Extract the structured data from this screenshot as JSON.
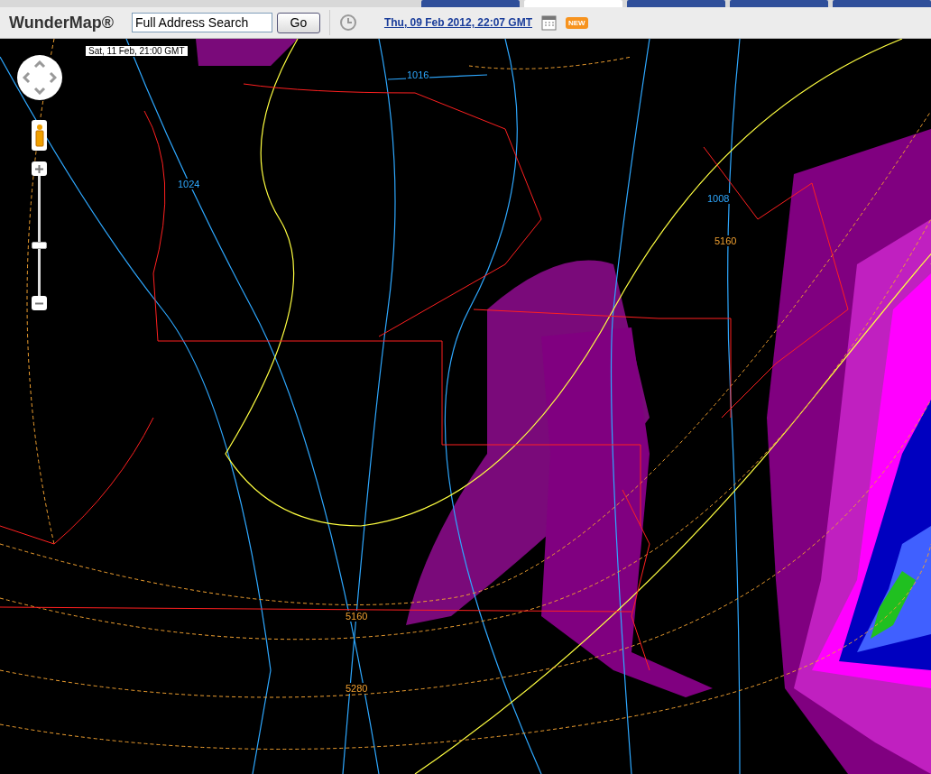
{
  "top_tabs": [
    {
      "selected": false
    },
    {
      "selected": true
    },
    {
      "selected": false
    },
    {
      "selected": false
    },
    {
      "selected": false
    }
  ],
  "toolbar": {
    "logo": "WunderMap®",
    "search": {
      "value": "Full Address Search"
    },
    "go_button": "Go",
    "date_link": "Thu, 09 Feb 2012, 22:07 GMT",
    "new_badge": "NEW"
  },
  "map": {
    "valid_time": "Sat, 11 Feb, 21:00 GMT",
    "zoom": {
      "level": 0.42
    },
    "contour_labels": [
      {
        "text": "1016",
        "kind": "pressure"
      },
      {
        "text": "1024",
        "kind": "pressure"
      },
      {
        "text": "1008",
        "kind": "pressure"
      },
      {
        "text": "5160",
        "kind": "height"
      },
      {
        "text": "5160",
        "kind": "height"
      },
      {
        "text": "5280",
        "kind": "height"
      }
    ]
  }
}
